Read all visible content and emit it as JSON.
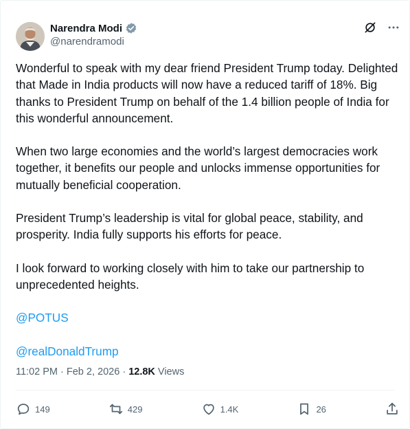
{
  "author": {
    "name": "Narendra Modi",
    "handle": "@narendramodi"
  },
  "top_actions": [
    {
      "icon": "grok-icon"
    },
    {
      "icon": "more-icon"
    }
  ],
  "body": {
    "paragraphs": [
      "Wonderful to speak with my dear friend President Trump today. Delighted that Made in India products will now have a reduced tariff of 18%. Big thanks to President Trump on behalf of the 1.4 billion people of India for this wonderful announcement.",
      "When two large economies and the world’s largest democracies work together, it benefits our people and unlocks immense opportunities for mutually beneficial cooperation.",
      "President Trump’s leadership is vital for global peace, stability, and prosperity. India fully supports his efforts for peace.",
      "I look forward to working closely with him to take our partnership to unprecedented heights."
    ],
    "mentions": [
      "@POTUS",
      "@realDonaldTrump"
    ]
  },
  "meta": {
    "time": "11:02 PM",
    "separator": " · ",
    "date": "Feb 2, 2026",
    "views_count": "12.8K",
    "views_label": " Views"
  },
  "actions": {
    "replies": "149",
    "reposts": "429",
    "likes": "1.4K",
    "bookmarks": "26"
  },
  "colors": {
    "accent": "#1d9bf0",
    "secondary_text": "#536471",
    "primary_text": "#0f1419"
  }
}
